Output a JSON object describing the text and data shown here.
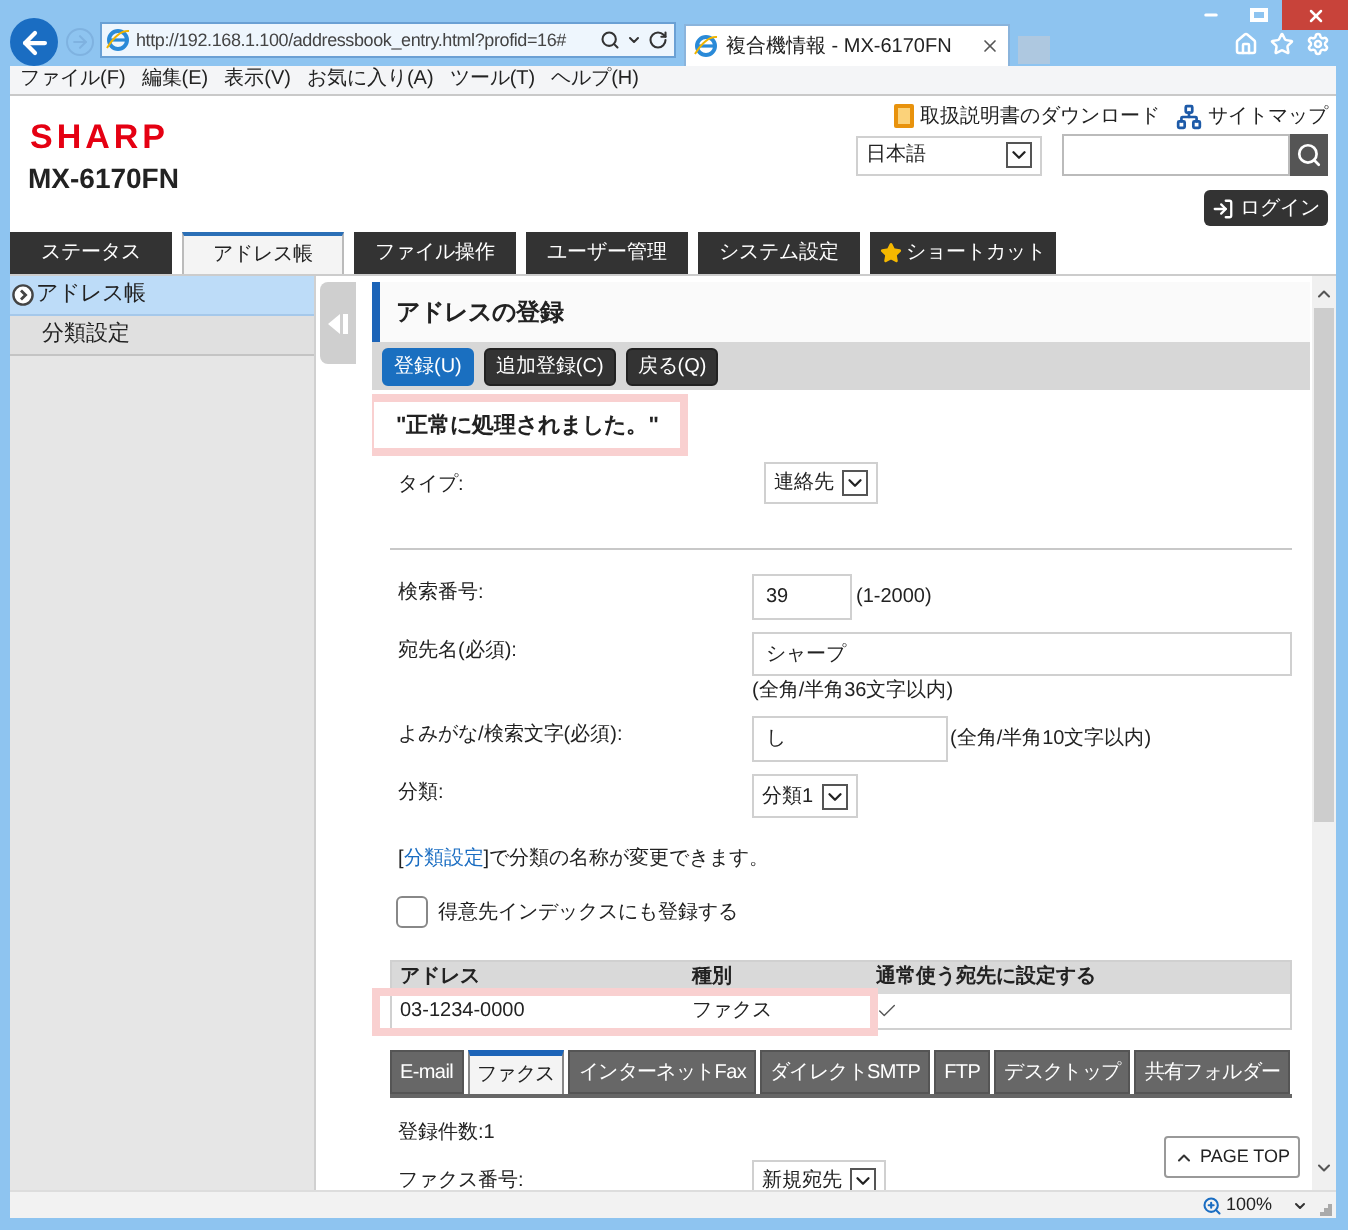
{
  "browser": {
    "address": "http://192.168.1.100/addressbook_entry.html?profid=16#",
    "tab_title": "複合機情報 - MX-6170FN",
    "menu": [
      "ファイル(F)",
      "編集(E)",
      "表示(V)",
      "お気に入り(A)",
      "ツール(T)",
      "ヘルプ(H)"
    ],
    "zoom": "100%"
  },
  "header": {
    "logo": "SHARP",
    "model": "MX-6170FN",
    "links": [
      {
        "label": "取扱説明書のダウンロード",
        "kind": "manual"
      },
      {
        "label": "サイトマップ",
        "kind": "sitemap"
      }
    ],
    "language": "日本語",
    "login": "ログイン"
  },
  "tabs": [
    {
      "label": "ステータス",
      "selected": false,
      "kind": "plain"
    },
    {
      "label": "アドレス帳",
      "selected": true,
      "kind": "plain"
    },
    {
      "label": "ファイル操作",
      "selected": false,
      "kind": "plain"
    },
    {
      "label": "ユーザー管理",
      "selected": false,
      "kind": "plain"
    },
    {
      "label": "システム設定",
      "selected": false,
      "kind": "plain"
    },
    {
      "label": "ショートカット",
      "selected": false,
      "kind": "shortcut"
    }
  ],
  "sidebar": {
    "items": [
      {
        "label": "アドレス帳",
        "selected": true
      },
      {
        "label": "分類設定",
        "selected": false
      }
    ]
  },
  "main": {
    "title": "アドレスの登録",
    "buttons": [
      {
        "label": "登録(U)",
        "kind": "primary"
      },
      {
        "label": "追加登録(C)",
        "kind": "secondary"
      },
      {
        "label": "戻る(Q)",
        "kind": "secondary"
      }
    ],
    "message": {
      "text": "\"正常に処理されました。\"",
      "highlighted": true
    },
    "type_field": {
      "label": "タイプ:",
      "value": "連絡先"
    },
    "fields": [
      {
        "label": "検索番号:",
        "kind": "number",
        "value": "39",
        "hint": "(1-2000)"
      },
      {
        "label": "宛先名(必須):",
        "kind": "name",
        "value": "シャープ",
        "hint": "(全角/半角36文字以内)"
      },
      {
        "label": "よみがな/検索文字(必須):",
        "kind": "reading",
        "value": "し",
        "hint": "(全角/半角10文字以内)"
      },
      {
        "label": "分類:",
        "kind": "select",
        "value": "分類1"
      }
    ],
    "note": {
      "before": "[",
      "link": "分類設定",
      "after": "]で分類の名称が変更できます。"
    },
    "index_checkbox": {
      "label": "得意先インデックスにも登録する",
      "checked": false
    },
    "address_table": {
      "columns": [
        "アドレス",
        "種別",
        "通常使う宛先に設定する"
      ],
      "rows": [
        {
          "cells": [
            "03-1234-0000",
            "ファクス"
          ],
          "default": true,
          "highlighted": true
        }
      ]
    },
    "address_tabs": [
      {
        "label": "E-mail",
        "selected": false
      },
      {
        "label": "ファクス",
        "selected": true
      },
      {
        "label": "インターネットFax",
        "selected": false
      },
      {
        "label": "ダイレクトSMTP",
        "selected": false
      },
      {
        "label": "FTP",
        "selected": false
      },
      {
        "label": "デスクトップ",
        "selected": false
      },
      {
        "label": "共有フォルダー",
        "selected": false
      }
    ],
    "count": "登録件数:1",
    "fax_number": {
      "label": "ファクス番号:",
      "value": "新規宛先"
    },
    "page_top": "PAGE TOP"
  }
}
